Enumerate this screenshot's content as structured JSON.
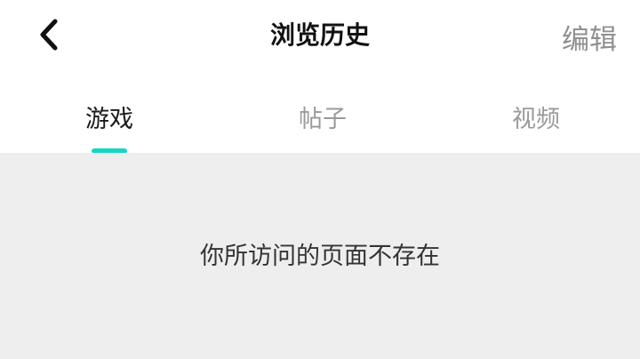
{
  "header": {
    "back_icon": "chevron-left-icon",
    "title": "浏览历史",
    "edit_label": "编辑"
  },
  "tabs": [
    {
      "label": "游戏",
      "active": true
    },
    {
      "label": "帖子",
      "active": false
    },
    {
      "label": "视频",
      "active": false
    }
  ],
  "content": {
    "message": "你所访问的页面不存在"
  },
  "colors": {
    "accent": "#16d6c3",
    "content_background": "#eeeeee",
    "inactive_text": "#9a9a9a"
  }
}
